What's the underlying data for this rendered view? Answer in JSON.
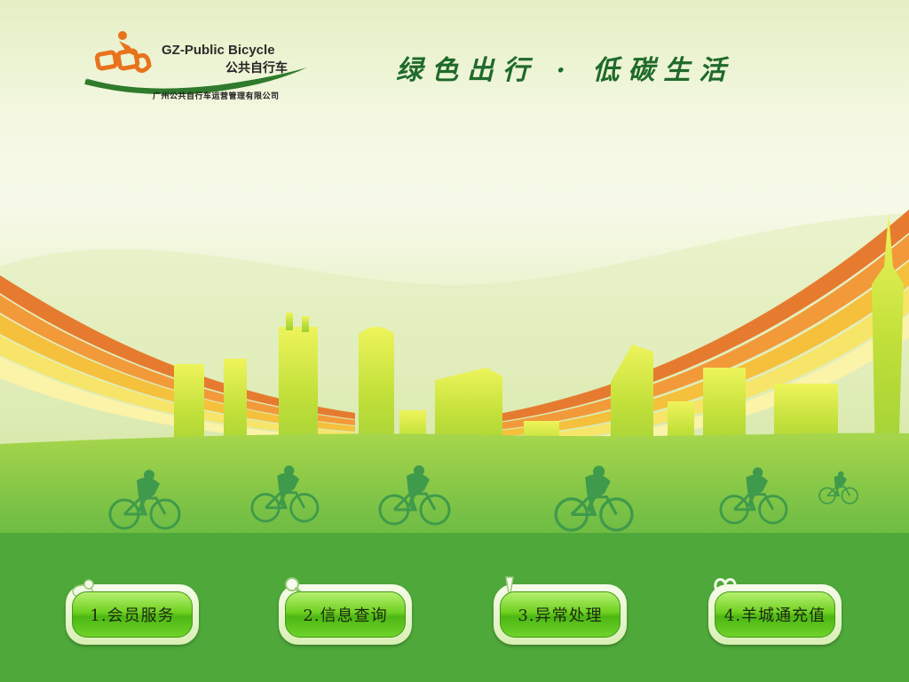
{
  "logo": {
    "title": "GZ-Public Bicycle",
    "subtitle": "公共自行车",
    "company": "广州公共自行车运营管理有限公司"
  },
  "slogan": "绿色出行 · 低碳生活",
  "menu": [
    {
      "label": "1.会员服务",
      "icon": "member-icon"
    },
    {
      "label": "2.信息查询",
      "icon": "magnifier-icon"
    },
    {
      "label": "3.异常处理",
      "icon": "exclamation-icon"
    },
    {
      "label": "4.羊城通充值",
      "icon": "heart-icon"
    }
  ],
  "colors": {
    "slogan": "#1f6a2a",
    "logo_orange": "#e8731d",
    "logo_green": "#2f7a2c",
    "button_green": "#5fc41e",
    "ribbon_orange": "#e67b2f",
    "ribbon_yellow": "#f2c33a",
    "city_lime": "#c2e03a",
    "grass_green": "#4aa538"
  }
}
